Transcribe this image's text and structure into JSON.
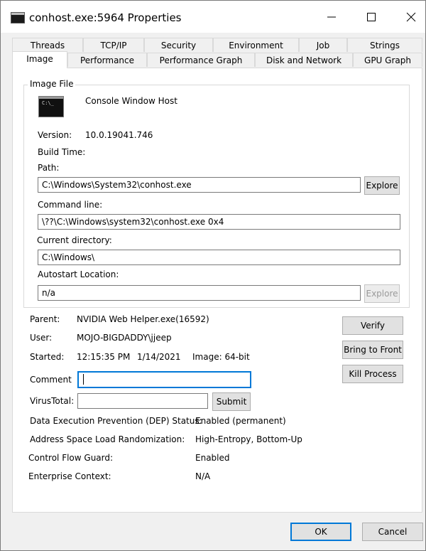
{
  "window": {
    "title": "conhost.exe:5964 Properties",
    "controls": [
      "minimize-icon",
      "maximize-icon",
      "close-icon"
    ]
  },
  "tabs": {
    "row1": [
      "Threads",
      "TCP/IP",
      "Security",
      "Environment",
      "Job",
      "Strings"
    ],
    "row2": [
      "Image",
      "Performance",
      "Performance Graph",
      "Disk and Network",
      "GPU Graph"
    ],
    "selected": "Image"
  },
  "image_file": {
    "group_title": "Image File",
    "description": "Console Window Host",
    "console_icon_text": "C:\\_",
    "version_label": "Version:",
    "version_value": "10.0.19041.746",
    "build_time_label": "Build Time:",
    "path_label": "Path:",
    "path_value": "C:\\Windows\\System32\\conhost.exe",
    "explore_label": "Explore",
    "command_line_label": "Command line:",
    "command_line_value": "\\??\\C:\\Windows\\system32\\conhost.exe 0x4",
    "current_directory_label": "Current directory:",
    "current_directory_value": "C:\\Windows\\",
    "autostart_label": "Autostart Location:",
    "autostart_value": "n/a",
    "autostart_explore_label": "Explore"
  },
  "process": {
    "parent_label": "Parent:",
    "parent_value": "NVIDIA Web Helper.exe(16592)",
    "user_label": "User:",
    "user_value": "MOJO-BIGDADDY\\jjeep",
    "started_label": "Started:",
    "started_time": "12:15:35 PM",
    "started_date": "1/14/2021",
    "image_bits": "Image: 64-bit",
    "comment_label": "Comment",
    "comment_value": "",
    "virustotal_label": "VirusTotal:",
    "virustotal_value": "",
    "submit_label": "Submit",
    "verify_label": "Verify",
    "bring_to_front_label": "Bring to Front",
    "kill_process_label": "Kill Process"
  },
  "security_info": [
    {
      "label": "Data Execution Prevention (DEP) Status:",
      "value": "Enabled (permanent)"
    },
    {
      "label": "Address Space Load Randomization:",
      "value": "High-Entropy, Bottom-Up"
    },
    {
      "label": "Control Flow Guard:",
      "value": "Enabled"
    },
    {
      "label": "Enterprise Context:",
      "value": "N/A"
    }
  ],
  "footer": {
    "ok_label": "OK",
    "cancel_label": "Cancel"
  },
  "colors": {
    "accent": "#0078d7",
    "window_bg": "#f0f0f0",
    "panel_bg": "#ffffff"
  }
}
